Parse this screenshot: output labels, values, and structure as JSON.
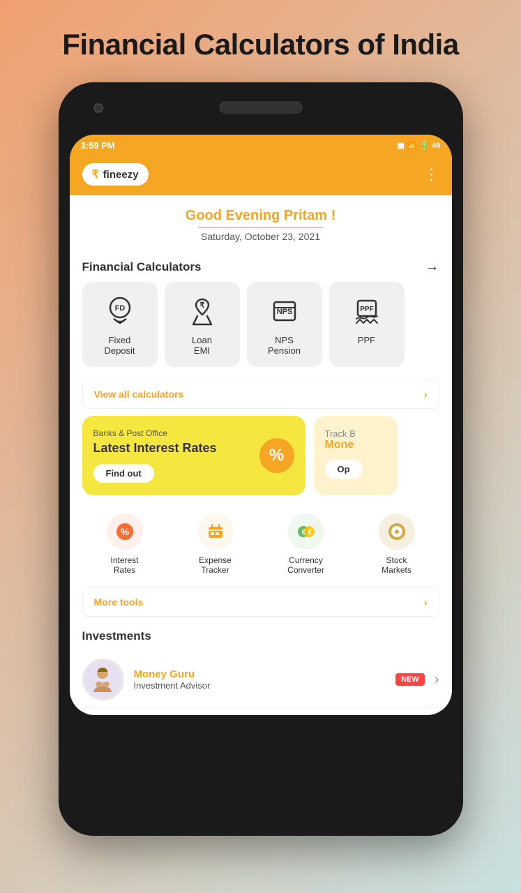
{
  "page": {
    "title": "Financial Calculators of India"
  },
  "status_bar": {
    "time": "3:59 PM",
    "battery": "49"
  },
  "header": {
    "logo_symbol": "₹",
    "logo_name": "fineezy",
    "menu_icon": "⋮"
  },
  "greeting": {
    "text": "Good Evening Pritam !",
    "date": "Saturday, October 23, 2021"
  },
  "financial_calculators": {
    "section_title": "Financial Calculators",
    "items": [
      {
        "label": "Fixed\nDeposit",
        "icon": "fd"
      },
      {
        "label": "Loan\nEMI",
        "icon": "loan"
      },
      {
        "label": "NPS\nPension",
        "icon": "nps"
      },
      {
        "label": "PPF",
        "icon": "ppf"
      }
    ],
    "view_all_label": "View all calculators"
  },
  "banners": [
    {
      "subtitle": "Banks & Post Office",
      "title": "Latest Interest Rates",
      "btn_label": "Find out",
      "icon": "%"
    },
    {
      "subtitle": "Track B",
      "title": "Mone",
      "btn_label": "Op"
    }
  ],
  "tools": {
    "items": [
      {
        "label": "Interest\nRates",
        "icon": "percent",
        "color": "#ff6b35"
      },
      {
        "label": "Expense\nTracker",
        "icon": "wallet",
        "color": "#f5a623"
      },
      {
        "label": "Currency\nConverter",
        "icon": "currency",
        "color": "#4caf50"
      },
      {
        "label": "Stock\nMarkets",
        "icon": "stock",
        "color": "#8b6914"
      }
    ],
    "more_label": "More tools"
  },
  "investments": {
    "section_title": "Investments",
    "items": [
      {
        "name": "Money Guru",
        "desc": "Investment Advisor",
        "badge": "NEW"
      }
    ]
  }
}
